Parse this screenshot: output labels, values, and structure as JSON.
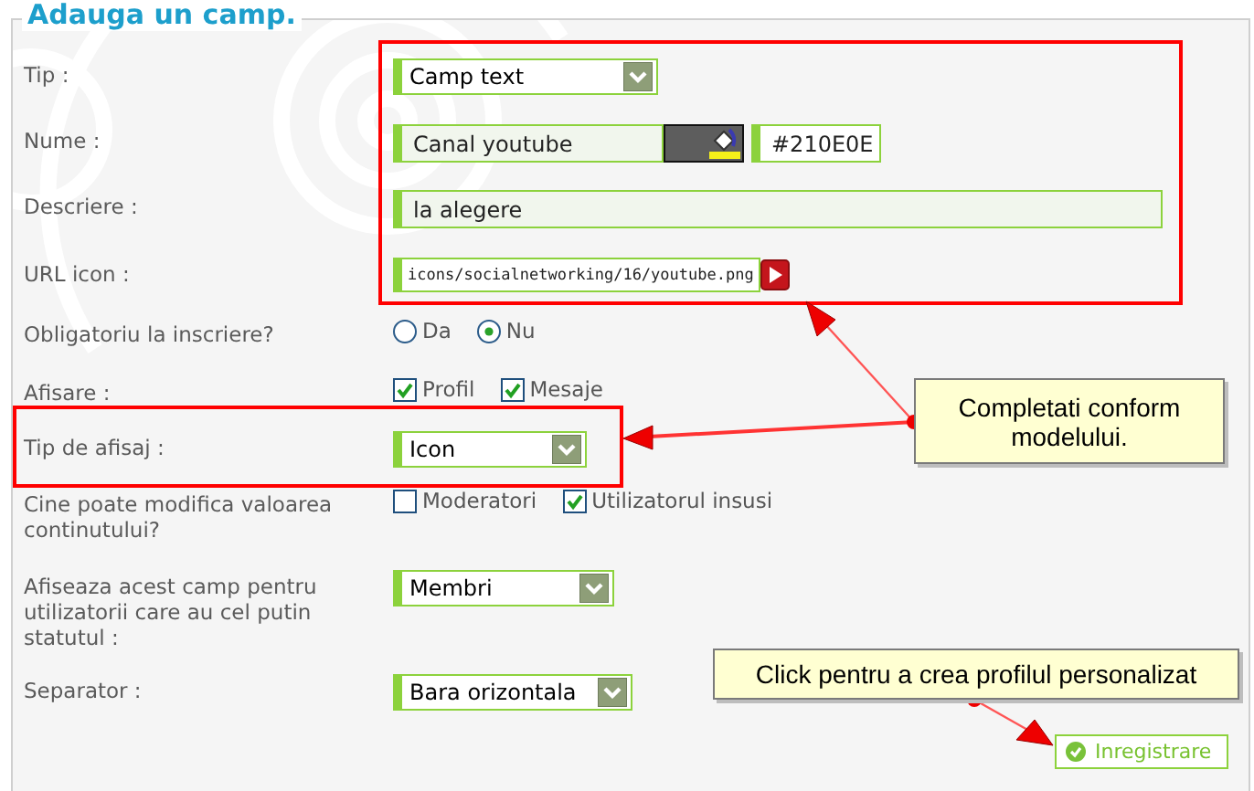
{
  "legend": "Adauga un camp.",
  "fields": [
    {
      "kind": "select",
      "label": "Tip :",
      "value": "Camp text"
    },
    {
      "kind": "text-color",
      "label": "Nume :",
      "value": "Canal youtube",
      "hex": "#210E0E"
    },
    {
      "kind": "text",
      "label": "Descriere :",
      "value": "la alegere"
    },
    {
      "kind": "url",
      "label": "URL icon :",
      "value": "icons/socialnetworking/16/youtube.png"
    },
    {
      "kind": "radio",
      "label": "Obligatoriu la inscriere?",
      "options": [
        {
          "label": "Da",
          "selected": false
        },
        {
          "label": "Nu",
          "selected": true
        }
      ]
    },
    {
      "kind": "checkboxes",
      "label": "Afisare :",
      "options": [
        {
          "label": "Profil",
          "checked": true
        },
        {
          "label": "Mesaje",
          "checked": true
        }
      ]
    },
    {
      "kind": "select",
      "label": "Tip de afisaj :",
      "value": "Icon"
    },
    {
      "kind": "checkboxes",
      "label": "Cine poate modifica valoarea continutului?",
      "options": [
        {
          "label": "Moderatori",
          "checked": false
        },
        {
          "label": "Utilizatorul insusi",
          "checked": true
        }
      ]
    },
    {
      "kind": "select",
      "label": "Afiseaza acest camp pentru utilizatorii care au cel putin statutul :",
      "value": "Membri"
    },
    {
      "kind": "select",
      "label": "Separator :",
      "value": "Bara orizontala"
    }
  ],
  "submit": "Inregistrare",
  "callouts": [
    {
      "text": "Completati conform modelului."
    },
    {
      "text": "Click pentru a crea profilul personalizat"
    }
  ]
}
